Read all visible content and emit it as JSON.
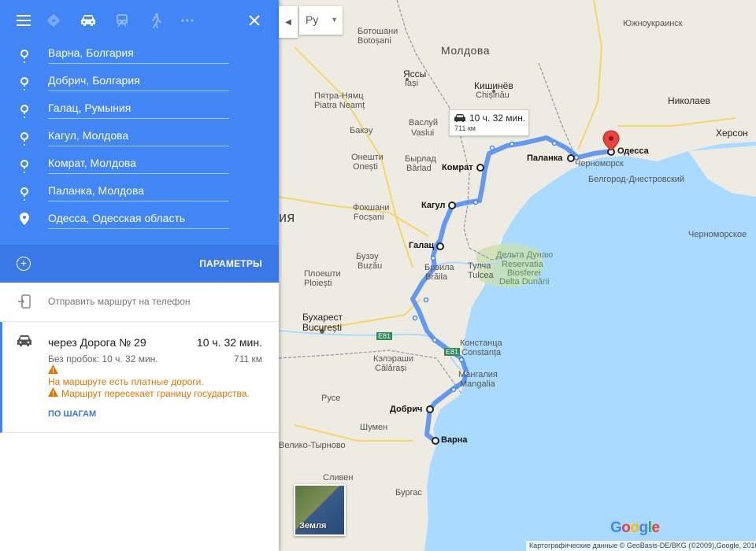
{
  "header": {
    "modes": [
      "menu-icon",
      "best-mode-icon",
      "car-icon",
      "transit-icon",
      "walk-icon",
      "more-icon"
    ],
    "close_icon": "close-icon"
  },
  "stops": [
    {
      "label": "Варна, Болгария"
    },
    {
      "label": "Добрич, Болгария"
    },
    {
      "label": "Галац, Румыния"
    },
    {
      "label": "Кагул, Молдова"
    },
    {
      "label": "Комрат, Молдова"
    },
    {
      "label": "Паланка, Молдова"
    },
    {
      "label": "Одесса, Одесская область"
    }
  ],
  "options": {
    "label": "ПАРАМЕТРЫ"
  },
  "send": {
    "label": "Отправить маршрут на телефон"
  },
  "route": {
    "via": "через Дорога № 29",
    "time": "10 ч. 32 мин.",
    "traffic": "Без пробок: 10 ч. 32 мин.",
    "distance": "711 км",
    "warnings": [
      "На маршруте есть платные дороги.",
      "Маршрут пересекает границу государства."
    ],
    "steps_label": "ПО ШАГАМ"
  },
  "map": {
    "lang": "Ру",
    "bubble": {
      "time": "10 ч. 32 мин.",
      "distance": "711 км"
    },
    "earth_label": "Земля",
    "attribution": "Картографические данные © GeoBasis-DE/BKG (©2009),Google, 2016",
    "labels": {
      "moldova": "Молдова",
      "region": "ия",
      "kishinev": "Кишинёв",
      "chisinau": "Chișinău",
      "yassy": "Яссы",
      "iasi": "Iași",
      "piatra_ru": "Пятра-Нямц",
      "piatra": "Piatra Neamț",
      "vaslui_ru": "Васлуй",
      "vaslui": "Vaslui",
      "barlad_ru": "Бырлад",
      "barlad": "Bârlad",
      "onesti_ru": "Онешти",
      "onesti": "Onești",
      "focsani_ru": "Фокшани",
      "focsani": "Focșani",
      "buzau_ru": "Бузэу",
      "buzau": "Buzău",
      "ploiesti_ru": "Плоешти",
      "ploiesti": "Ploiești",
      "bucharest_ru": "Бухарест",
      "bucharest": "București",
      "calarasi_ru": "Кэлэраши",
      "calarasi": "Călărași",
      "ruse": "Русе",
      "shumen": "Шумен",
      "vtarnovo": "Велико-Тырново",
      "sliven": "Сливен",
      "burgas": "Бургас",
      "braila_ru": "Брэила",
      "braila": "Brăila",
      "tulcea_ru": "Тулча",
      "tulcea": "Tulcea",
      "constanta_ru": "Констанца",
      "constanta": "Constanța",
      "mangalia_ru": "Мангалия",
      "mangalia": "Mangalia",
      "delta_ru": "Дельта Дунаю",
      "delta1": "Reservatia",
      "delta2": "Biosferei",
      "delta3": "Delta Dunării",
      "nikolaev": "Николаев",
      "kherson": "Херсон",
      "yuzhnoukrainsk": "Южноукраинск",
      "chernomorsk": "Черноморск",
      "belgorod": "Белгород-Днестровский",
      "chernomorskoe": "Черноморское",
      "botoshani_ru": "Ботошани",
      "botosani": "Botoșani",
      "bacau_ru": "Бакэу",
      "galati_ru": "Галац",
      "komrat": "Комрат",
      "kagul": "Кагул",
      "palanka": "Паланка",
      "odessa": "Одесса",
      "dobrich": "Добрич",
      "varna": "Варна",
      "e81": "E81",
      "e81b": "E81"
    }
  },
  "chart_data": null
}
